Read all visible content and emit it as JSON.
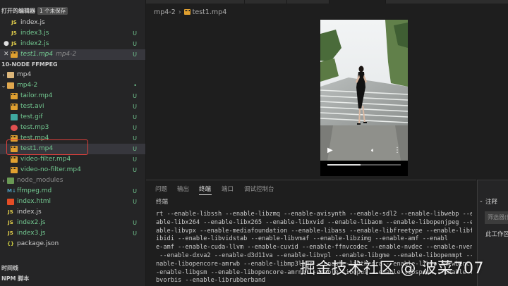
{
  "sidebar": {
    "open_editors_header": "打开的编辑器",
    "unsaved_badge": "1 个未保存",
    "open_editors": [
      {
        "label": "index.js",
        "status": ""
      },
      {
        "label": "index3.js",
        "status": "U"
      },
      {
        "label": "index2.js",
        "status": "U"
      },
      {
        "label": "test1.mp4",
        "desc": "mp4-2",
        "status": "U"
      }
    ],
    "project_header": "10-NODE FFMPEG",
    "tree": [
      {
        "label": "mp4",
        "status": ""
      },
      {
        "label": "mp4-2",
        "status": "•"
      },
      {
        "label": "tailor.mp4",
        "status": "U"
      },
      {
        "label": "test.avi",
        "status": "U"
      },
      {
        "label": "test.gif",
        "status": "U"
      },
      {
        "label": "test.mp3",
        "status": "U"
      },
      {
        "label": "test.mp4",
        "status": "U"
      },
      {
        "label": "test1.mp4",
        "status": "U"
      },
      {
        "label": "video-filter.mp4",
        "status": "U"
      },
      {
        "label": "video-no-filter.mp4",
        "status": "U"
      },
      {
        "label": "node_modules",
        "status": ""
      },
      {
        "label": "ffmpeg.md",
        "status": "U"
      },
      {
        "label": "index.html",
        "status": "U"
      },
      {
        "label": "index.js",
        "status": ""
      },
      {
        "label": "index2.js",
        "status": "U"
      },
      {
        "label": "index3.js",
        "status": "U"
      },
      {
        "label": "package.json",
        "status": ""
      }
    ],
    "timeline_header": "时间线",
    "npm_header": "NPM 脚本"
  },
  "editor": {
    "breadcrumb": [
      "mp4-2",
      "test1.mp4"
    ]
  },
  "video": {
    "progress": 0.45
  },
  "panel": {
    "tabs": [
      "问题",
      "输出",
      "终端",
      "端口",
      "调试控制台"
    ],
    "active_tab_index": 2,
    "terminal_title": "终端",
    "terminal_lines": [
      "rt --enable-libssh --enable-libzmq --enable-avisynth --enable-sdl2 --enable-libwebp --en",
      "able-libx264 --enable-libx265 --enable-libxvid --enable-libaom --enable-libopenjpeg --en",
      "able-libvpx --enable-mediafoundation --enable-libass --enable-libfreetype --enable-libfr",
      "ibidi --enable-libvidstab --enable-libvmaf --enable-libzimg --enable-amf --enabl",
      "e-amf --enable-cuda-llvm --enable-cuvid --enable-ffnvcodec --enable-nvdec --enable-nvenc",
      " --enable-dxva2 --enable-d3d11va --enable-libvpl --enable-libgme --enable-libopenmpt --e",
      "nable-libopencore-amrwb --enable-libmp3lame --enable-libtheora --enable-libvo-amrwbenc -",
      "-enable-libgsm --enable-libopencore-amrnb --enable-libopus --enable-libspeex --enable-li",
      "bvorbis --enable-librubberband"
    ]
  },
  "aux_panel": {
    "title": "注释",
    "filter_placeholder": "筛选器(例如",
    "text": "此工作区"
  },
  "watermark": "掘金技术社区 @ 波菜707",
  "colors": {
    "git_untracked": "#73c991",
    "highlight_box": "#e0403b",
    "background": "#1e1e1e",
    "sidebar": "#252526"
  }
}
